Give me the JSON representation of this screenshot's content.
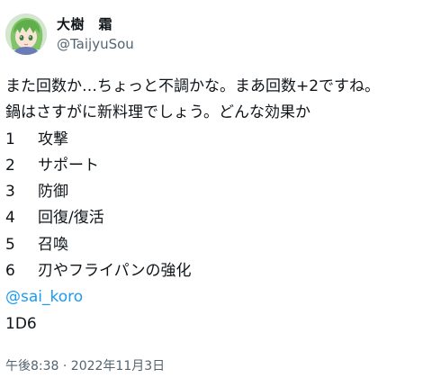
{
  "author": {
    "display_name": "大樹　霜",
    "handle": "@TaijyuSou",
    "avatar_icon": "anime-character-avatar-icon"
  },
  "tweet": {
    "line1": "また回数か…ちょっと不調かな。まあ回数+2ですね。",
    "line2": "鍋はさすがに新料理でしょう。どんな効果か",
    "list": [
      {
        "num": "1",
        "text": "攻撃"
      },
      {
        "num": "2",
        "text": "サポート"
      },
      {
        "num": "3",
        "text": "防御"
      },
      {
        "num": "4",
        "text": "回復/復活"
      },
      {
        "num": "5",
        "text": "召喚"
      },
      {
        "num": "6",
        "text": "刃やフライパンの強化"
      }
    ],
    "mention": "@sai_koro",
    "dice": "1D6"
  },
  "footer": {
    "timestamp": "午後8:38 · 2022年11月3日"
  },
  "colors": {
    "text": "#0f1419",
    "secondary": "#536471",
    "link": "#1d9bf0"
  }
}
